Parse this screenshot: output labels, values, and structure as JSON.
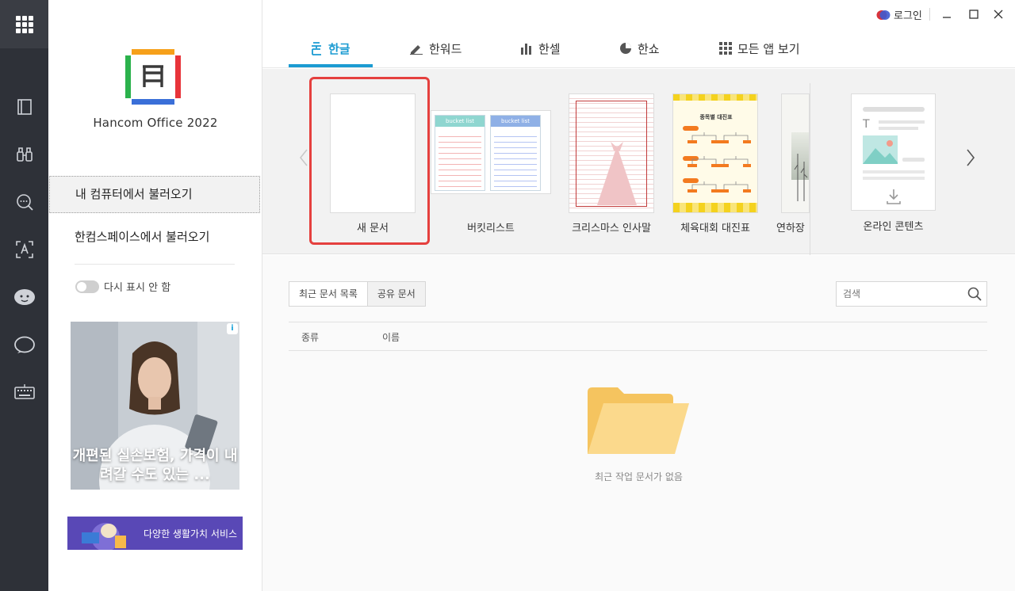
{
  "app": {
    "brand_name": "Hancom Office 2022"
  },
  "colors": {
    "accent": "#1b9bd2",
    "highlight_frame": "#e5403e",
    "rail_bg": "#2e3138",
    "folder": "#fbd17b"
  },
  "rail": {
    "icons": [
      "apps-grid-icon",
      "notebook-icon",
      "binoculars-icon",
      "chat-search-icon",
      "text-recognition-icon",
      "bean-character-icon",
      "cloud-chat-icon",
      "keyboard-icon"
    ]
  },
  "panel": {
    "open_local_label": "내 컴퓨터에서 불러오기",
    "open_cloud_label": "한컴스페이스에서 불러오기",
    "dont_show_label": "다시 표시 안 함",
    "ad1_text": "개편된 실손보험, 가격이 내려갈 수도 있는 ...",
    "ad1_badge": "i",
    "ad2_text": "다양한 생활가치 서비스"
  },
  "titlebar": {
    "login_label": "로그인"
  },
  "tabs": [
    {
      "label": "한글",
      "icon": "hangul-icon",
      "active": true
    },
    {
      "label": "한워드",
      "icon": "pen-icon",
      "active": false
    },
    {
      "label": "한셀",
      "icon": "bar-chart-icon",
      "active": false
    },
    {
      "label": "한쇼",
      "icon": "pie-chart-icon",
      "active": false
    },
    {
      "label": "모든 앱 보기",
      "icon": "grid-icon",
      "active": false
    }
  ],
  "templates": [
    {
      "label": "새 문서",
      "thumb_texts": []
    },
    {
      "label": "버킷리스트",
      "thumb_texts": [
        "bucket list",
        "bucket list"
      ]
    },
    {
      "label": "크리스마스 인사말",
      "thumb_texts": []
    },
    {
      "label": "체육대회 대진표",
      "thumb_texts": [
        "종목별 대진표"
      ]
    },
    {
      "label": "연하장",
      "thumb_texts": []
    },
    {
      "label": "온라인 콘텐츠",
      "thumb_texts": []
    }
  ],
  "recent": {
    "tab_recent": "최근 문서 목록",
    "tab_shared": "공유 문서",
    "search_placeholder": "검색",
    "col_type": "종류",
    "col_name": "이름",
    "empty_message": "최근 작업 문서가 없음"
  }
}
